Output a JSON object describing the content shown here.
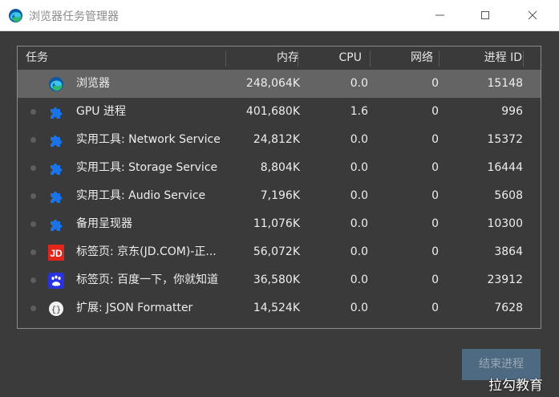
{
  "window": {
    "title": "浏览器任务管理器",
    "icon": "edge-browser-icon"
  },
  "table": {
    "headers": {
      "task": "任务",
      "memory": "内存",
      "cpu": "CPU",
      "network": "网络",
      "pid": "进程 ID"
    },
    "rows": [
      {
        "icon": "edge-browser-icon",
        "name": "浏览器",
        "memory": "248,064K",
        "cpu": "0.0",
        "network": "0",
        "pid": "15148",
        "selected": true
      },
      {
        "icon": "puzzle-icon",
        "name": "GPU 进程",
        "memory": "401,680K",
        "cpu": "1.6",
        "network": "0",
        "pid": "996"
      },
      {
        "icon": "puzzle-icon",
        "name": "实用工具: Network Service",
        "memory": "24,812K",
        "cpu": "0.0",
        "network": "0",
        "pid": "15372"
      },
      {
        "icon": "puzzle-icon",
        "name": "实用工具: Storage Service",
        "memory": "8,804K",
        "cpu": "0.0",
        "network": "0",
        "pid": "16444"
      },
      {
        "icon": "puzzle-icon",
        "name": "实用工具: Audio Service",
        "memory": "7,196K",
        "cpu": "0.0",
        "network": "0",
        "pid": "5608"
      },
      {
        "icon": "puzzle-icon",
        "name": "备用呈现器",
        "memory": "11,076K",
        "cpu": "0.0",
        "network": "0",
        "pid": "10300"
      },
      {
        "icon": "jd-favicon",
        "name": "标签页: 京东(JD.COM)-正...",
        "memory": "56,072K",
        "cpu": "0.0",
        "network": "0",
        "pid": "3864"
      },
      {
        "icon": "baidu-favicon",
        "name": "标签页: 百度一下，你就知道",
        "memory": "36,580K",
        "cpu": "0.0",
        "network": "0",
        "pid": "23912"
      },
      {
        "icon": "json-formatter-icon",
        "name": "扩展: JSON Formatter",
        "memory": "14,524K",
        "cpu": "0.0",
        "network": "0",
        "pid": "7628"
      }
    ]
  },
  "actions": {
    "end_process_label": "结束进程"
  },
  "watermark": "拉勾教育",
  "colors": {
    "background": "#3b3b3b",
    "selected_row": "#646464",
    "puzzle_blue": "#1a73e8",
    "jd_red": "#e1251b",
    "baidu_blue": "#2932e1",
    "button_bg": "#4e6a82"
  }
}
